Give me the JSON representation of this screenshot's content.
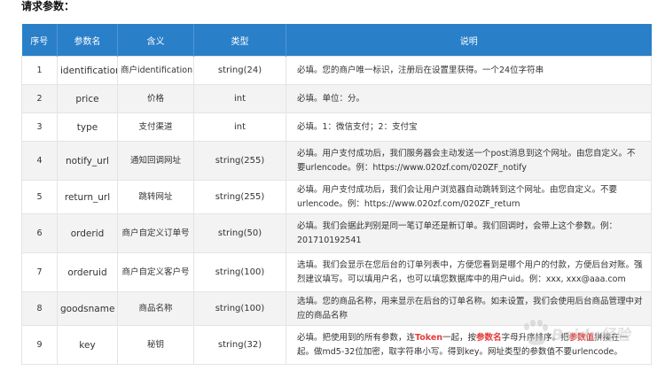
{
  "heading": "请求参数：",
  "columns": [
    "序号",
    "参数名",
    "含义",
    "类型",
    "说明"
  ],
  "rows": [
    {
      "no": "1",
      "name": "identification",
      "meaning": "商户identification",
      "type": "string(24)",
      "desc": "必填。您的商户唯一标识，注册后在设置里获得。一个24位字符串"
    },
    {
      "no": "2",
      "name": "price",
      "meaning": "价格",
      "type": "int",
      "desc": "必填。单位：分。"
    },
    {
      "no": "3",
      "name": "type",
      "meaning": "支付渠道",
      "type": "int",
      "desc": "必填。1：微信支付；2：支付宝"
    },
    {
      "no": "4",
      "name": "notify_url",
      "meaning": "通知回调网址",
      "type": "string(255)",
      "desc": "必填。用户支付成功后，我们服务器会主动发送一个post消息到这个网址。由您自定义。不要urlencode。例：https://www.020zf.com/020ZF_notify"
    },
    {
      "no": "5",
      "name": "return_url",
      "meaning": "跳转网址",
      "type": "string(255)",
      "desc": "必填。用户支付成功后，我们会让用户浏览器自动跳转到这个网址。由您自定义。不要urlencode。例：https://www.020zf.com/020ZF_return"
    },
    {
      "no": "6",
      "name": "orderid",
      "meaning": "商户自定义订单号",
      "type": "string(50)",
      "desc": "必填。我们会据此判别是同一笔订单还是新订单。我们回调时，会带上这个参数。例：201710192541"
    },
    {
      "no": "7",
      "name": "orderuid",
      "meaning": "商户自定义客户号",
      "type": "string(100)",
      "desc": "选填。我们会显示在您后台的订单列表中，方便您看到是哪个用户的付款，方便后台对账。强烈建议填写。可以填用户名，也可以填您数据库中的用户uid。例：xxx, xxx@aaa.com"
    },
    {
      "no": "8",
      "name": "goodsname",
      "meaning": "商品名称",
      "type": "string(100)",
      "desc": "选填。您的商品名称，用来显示在后台的订单名称。如未设置，我们会使用后台商品管理中对应的商品名称"
    },
    {
      "no": "9",
      "name": "key",
      "meaning": "秘钥",
      "type": "string(32)",
      "desc_pre": "必填。把使用到的所有参数，连",
      "desc_hl1": "Token",
      "desc_mid1": "一起，按",
      "desc_hl2": "参数名",
      "desc_mid2": "字母升序排序。把",
      "desc_hl3": "参数值",
      "desc_post": "拼接在一起。做md5-32位加密，取字符串小写。得到key。网址类型的参数值不要urlencode。"
    }
  ],
  "watermark": "Baidu 经验"
}
